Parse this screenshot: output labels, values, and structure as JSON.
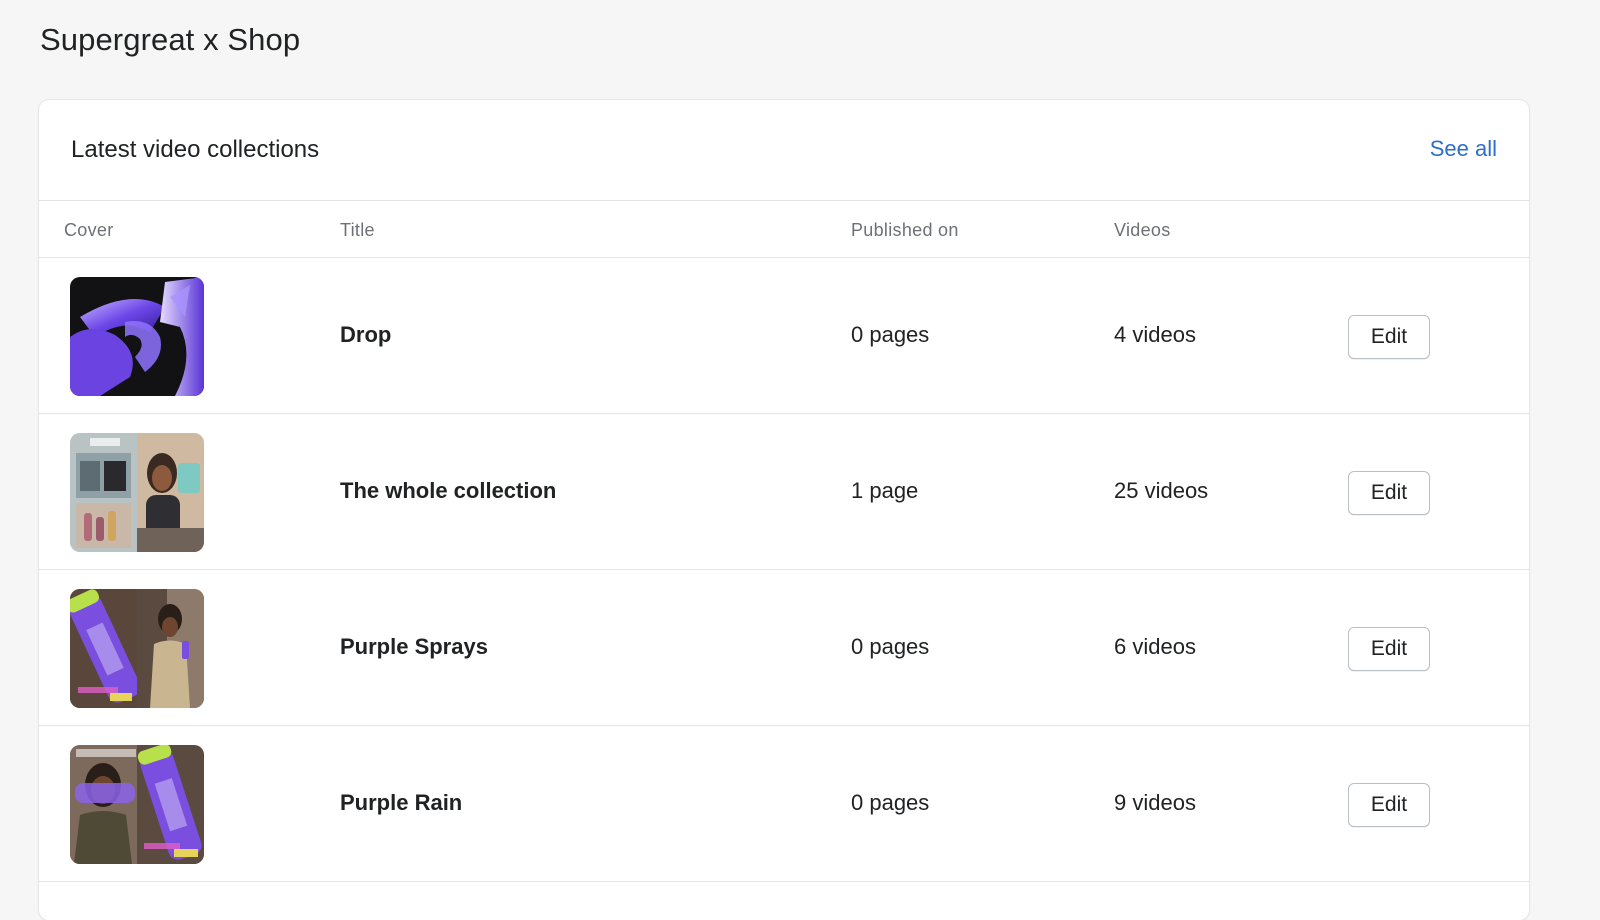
{
  "page": {
    "title": "Supergreat x Shop"
  },
  "card": {
    "title": "Latest video collections",
    "see_all_label": "See all"
  },
  "table": {
    "headers": {
      "cover": "Cover",
      "title": "Title",
      "published_on": "Published on",
      "videos": "Videos"
    },
    "rows": [
      {
        "title": "Drop",
        "published_on": "0 pages",
        "videos": "4 videos",
        "edit_label": "Edit",
        "cover_icon": "abstract-purple-3d-shape"
      },
      {
        "title": "The whole collection",
        "published_on": "1 page",
        "videos": "25 videos",
        "edit_label": "Edit",
        "cover_icon": "video-collage-fridge-woman"
      },
      {
        "title": "Purple Sprays",
        "published_on": "0 pages",
        "videos": "6 videos",
        "edit_label": "Edit",
        "cover_icon": "purple-spray-bottle-collage"
      },
      {
        "title": "Purple Rain",
        "published_on": "0 pages",
        "videos": "9 videos",
        "edit_label": "Edit",
        "cover_icon": "purple-spray-bottle-collage"
      }
    ]
  },
  "colors": {
    "background": "#f6f6f6",
    "card": "#ffffff",
    "link": "#2c6ecb",
    "border": "#e1e3e5",
    "muted_text": "#6d7175"
  }
}
